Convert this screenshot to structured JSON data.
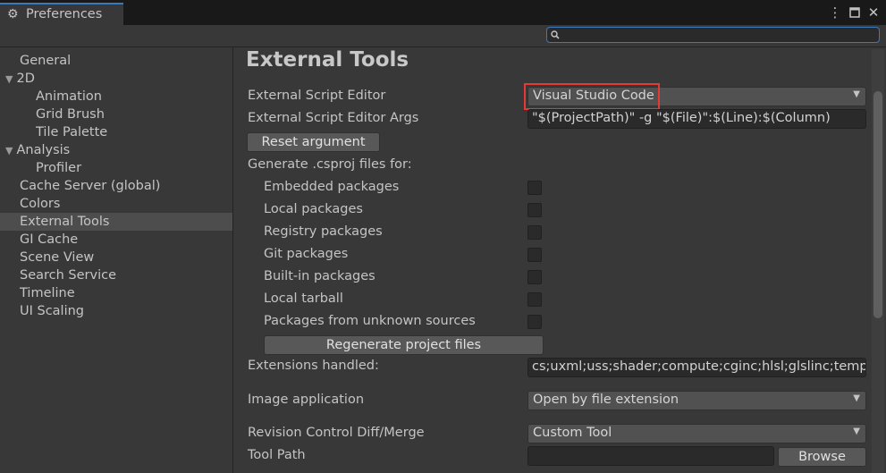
{
  "window": {
    "tab_title": "Preferences",
    "tab_icon": "gear-icon",
    "menu_icon": "kebab-menu-icon",
    "maximize_icon": "maximize-icon",
    "close_icon": "close-icon"
  },
  "search": {
    "value": "",
    "icon": "search-icon"
  },
  "sidebar": {
    "items": [
      {
        "label": "General"
      },
      {
        "label": "2D"
      },
      {
        "label": "Animation"
      },
      {
        "label": "Grid Brush"
      },
      {
        "label": "Tile Palette"
      },
      {
        "label": "Analysis"
      },
      {
        "label": "Profiler"
      },
      {
        "label": "Cache Server (global)"
      },
      {
        "label": "Colors"
      },
      {
        "label": "External Tools"
      },
      {
        "label": "GI Cache"
      },
      {
        "label": "Scene View"
      },
      {
        "label": "Search Service"
      },
      {
        "label": "Timeline"
      },
      {
        "label": "UI Scaling"
      }
    ],
    "selected": "External Tools"
  },
  "main": {
    "title": "External Tools",
    "script_editor": {
      "label": "External Script Editor",
      "value": "Visual Studio Code"
    },
    "script_editor_args": {
      "label": "External Script Editor Args",
      "value": "\"$(ProjectPath)\" -g \"$(File)\":$(Line):$(Column)"
    },
    "reset_button": "Reset argument",
    "csproj_label": "Generate .csproj files for:",
    "packages": [
      {
        "label": "Embedded packages",
        "checked": false
      },
      {
        "label": "Local packages",
        "checked": false
      },
      {
        "label": "Registry packages",
        "checked": false
      },
      {
        "label": "Git packages",
        "checked": false
      },
      {
        "label": "Built-in packages",
        "checked": false
      },
      {
        "label": "Local tarball",
        "checked": false
      },
      {
        "label": "Packages from unknown sources",
        "checked": false
      }
    ],
    "regenerate_button": "Regenerate project files",
    "extensions": {
      "label": "Extensions handled:",
      "value": "cs;uxml;uss;shader;compute;cginc;hlsl;glslinc;templ"
    },
    "image_app": {
      "label": "Image application",
      "value": "Open by file extension"
    },
    "revision": {
      "label": "Revision Control Diff/Merge",
      "value": "Custom Tool"
    },
    "tool_path": {
      "label": "Tool Path",
      "value": "",
      "browse": "Browse"
    }
  },
  "colors": {
    "highlight": "#e53935",
    "accent": "#3a79bb",
    "selected_bg": "#4d4d4d"
  }
}
